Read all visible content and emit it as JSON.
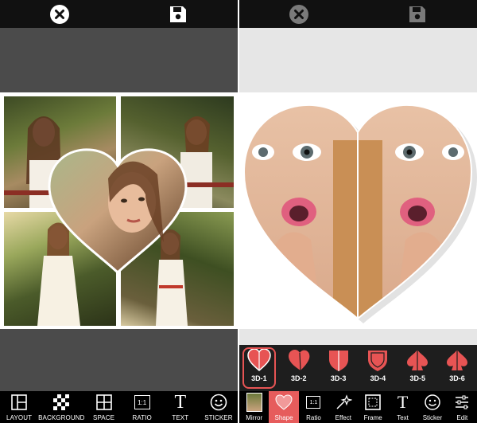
{
  "left": {
    "toolbar": [
      {
        "label": "LAYOUT",
        "icon": "layout-icon"
      },
      {
        "label": "BACKGROUND",
        "icon": "checker-icon"
      },
      {
        "label": "SPACE",
        "icon": "grid-icon"
      },
      {
        "label": "RATIO",
        "icon": "ratio-icon"
      },
      {
        "label": "TEXT",
        "icon": "text-icon"
      },
      {
        "label": "STICKER",
        "icon": "smiley-icon"
      }
    ],
    "ratio_glyph": "1:1",
    "text_glyph": "T"
  },
  "right": {
    "shapes": [
      {
        "label": "3D-1",
        "selected": true
      },
      {
        "label": "3D-2"
      },
      {
        "label": "3D-3"
      },
      {
        "label": "3D-4"
      },
      {
        "label": "3D-5"
      },
      {
        "label": "3D-6"
      }
    ],
    "toolbar": [
      {
        "label": "Mirror",
        "icon": "mirror-thumb-icon"
      },
      {
        "label": "Shape",
        "icon": "heart-shape-icon",
        "active": true
      },
      {
        "label": "Ratio",
        "icon": "ratio-icon"
      },
      {
        "label": "Effect",
        "icon": "sparkle-icon"
      },
      {
        "label": "Frame",
        "icon": "frame-icon"
      },
      {
        "label": "Text",
        "icon": "text-icon"
      },
      {
        "label": "Sticker",
        "icon": "smiley-icon"
      },
      {
        "label": "Edit",
        "icon": "sliders-icon"
      }
    ],
    "ratio_glyph": "1:1",
    "text_glyph": "T"
  },
  "colors": {
    "accent": "#e65c5c",
    "bar": "#000000",
    "strip": "#1e1e1e",
    "grey_left": "#4b4b4b",
    "grey_right": "#e6e6e6"
  }
}
